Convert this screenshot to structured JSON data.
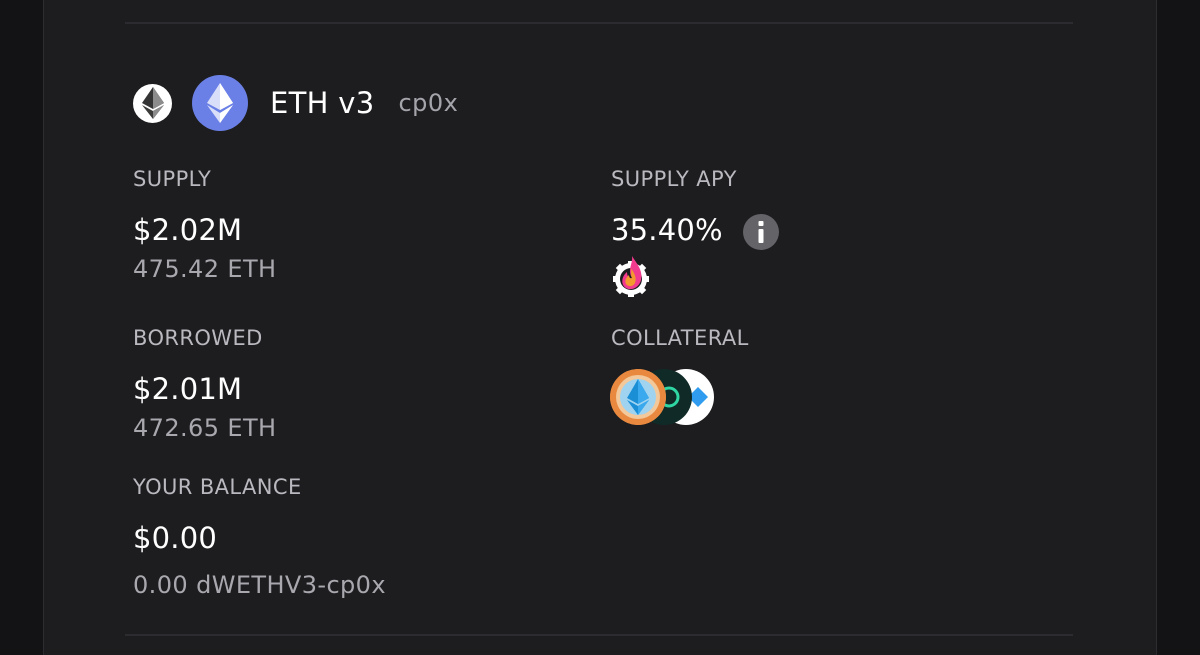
{
  "vault": {
    "name": "ETH v3",
    "curator": "cp0x",
    "chain_icon": "ethereum-chain-icon",
    "token_icon": "eth-token-icon"
  },
  "supply": {
    "label": "SUPPLY",
    "usd": "$2.02M",
    "amount": "475.42 ETH"
  },
  "supply_apy": {
    "label": "SUPPLY APY",
    "value": "35.40%",
    "info_icon": "info-icon",
    "reward_icon": "flame-gear-reward-icon"
  },
  "borrowed": {
    "label": "BORROWED",
    "usd": "$2.01M",
    "amount": "472.65 ETH"
  },
  "collateral": {
    "label": "COLLATERAL",
    "icons": [
      "eth-lst-token-icon",
      "green-ring-token-icon",
      "blue-diamond-token-icon"
    ]
  },
  "balance": {
    "label": "YOUR BALANCE",
    "usd": "$0.00",
    "amount": "0.00 dWETHV3-cp0x"
  },
  "colors": {
    "background": "#1d1d1f",
    "page": "#131315",
    "text_primary": "#ffffff",
    "text_secondary": "#a8a8ae",
    "eth_blue": "#6a80e6",
    "info_gray": "#636368"
  }
}
